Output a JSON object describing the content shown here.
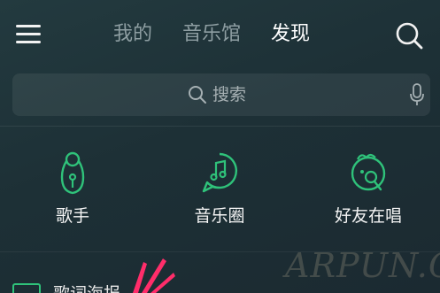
{
  "tabs": [
    "我的",
    "音乐馆",
    "发现"
  ],
  "search": {
    "placeholder": "搜索"
  },
  "features": [
    {
      "label": "歌手",
      "icon": "singer-icon"
    },
    {
      "label": "音乐圈",
      "icon": "music-circle-icon"
    },
    {
      "label": "好友在唱",
      "icon": "friends-singing-icon"
    }
  ],
  "bottom": {
    "label": "歌词海报"
  },
  "watermark": "ARPUN.COM",
  "colors": {
    "accent": "#2fc27a",
    "background": "#1e3238"
  }
}
